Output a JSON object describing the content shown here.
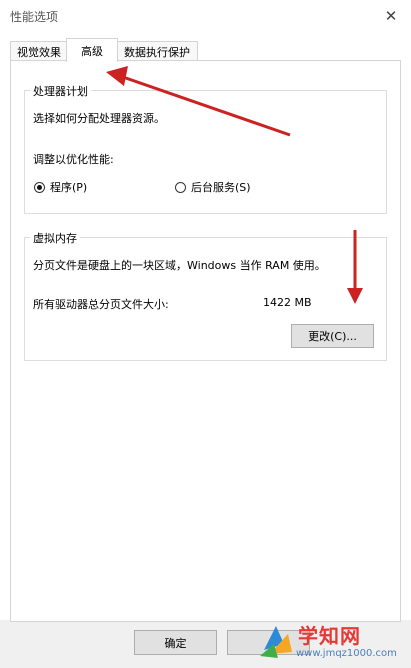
{
  "window": {
    "title": "性能选项",
    "close_glyph": "✕"
  },
  "tabs": [
    {
      "label": "视觉效果",
      "active": false
    },
    {
      "label": "高级",
      "active": true
    },
    {
      "label": "数据执行保护",
      "active": false
    }
  ],
  "processor": {
    "legend": "处理器计划",
    "description": "选择如何分配处理器资源。",
    "optimize_label": "调整以优化性能:",
    "options": [
      {
        "label": "程序(P)",
        "selected": true
      },
      {
        "label": "后台服务(S)",
        "selected": false
      }
    ]
  },
  "virtual_memory": {
    "legend": "虚拟内存",
    "description": "分页文件是硬盘上的一块区域，Windows 当作 RAM 使用。",
    "total_label": "所有驱动器总分页文件大小:",
    "total_value": "1422 MB",
    "change_button": "更改(C)..."
  },
  "footer": {
    "ok_button": "确定"
  },
  "watermark": {
    "brand": "学知网",
    "url": "www.jmqz1000.com"
  },
  "colors": {
    "annotation_arrow": "#cc2222"
  }
}
